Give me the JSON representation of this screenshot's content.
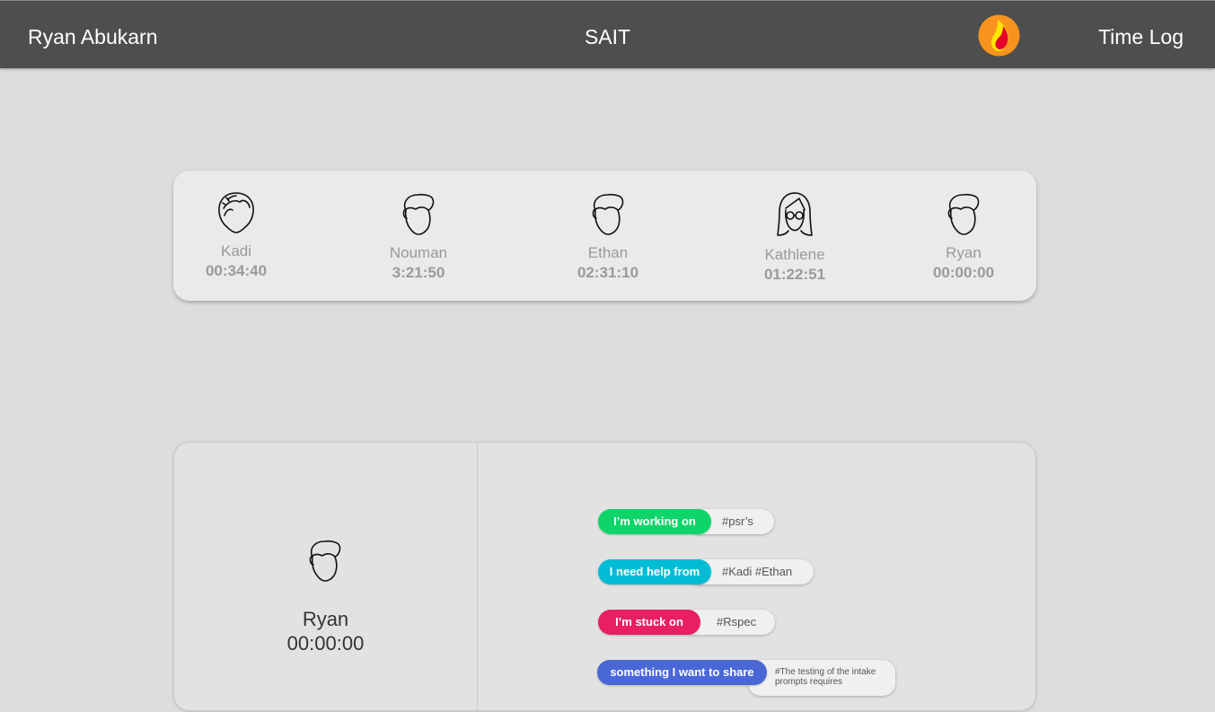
{
  "header": {
    "user_name": "Ryan Abukarn",
    "org_name": "SAIT",
    "nav_label": "Time Log",
    "logo_icon": "flame-logo"
  },
  "team": [
    {
      "name": "Kadi",
      "time": "00:34:40",
      "avatar": "female-short-hair-icon"
    },
    {
      "name": "Nouman",
      "time": "3:21:50",
      "avatar": "male-avatar-icon"
    },
    {
      "name": "Ethan",
      "time": "02:31:10",
      "avatar": "male-avatar-icon"
    },
    {
      "name": "Kathlene",
      "time": "01:22:51",
      "avatar": "female-glasses-avatar-icon"
    },
    {
      "name": "Ryan",
      "time": "00:00:00",
      "avatar": "male-avatar-icon"
    }
  ],
  "selected": {
    "name": "Ryan",
    "time": "00:00:00",
    "avatar": "male-avatar-icon"
  },
  "statuses": [
    {
      "label": "I’m working on",
      "value": "#psr’s",
      "color": "#0fd46a"
    },
    {
      "label": "I need help from",
      "value": "#Kadi #Ethan",
      "color": "#00bcd4"
    },
    {
      "label": "I’m stuck on",
      "value": "#Rspec",
      "color": "#e91e63"
    },
    {
      "label": "something I want to share",
      "value": "#The testing of the intake prompts requires",
      "color": "#4a67d6"
    }
  ],
  "colors": {
    "topbar": "#4e4e4e",
    "background": "#dddddd",
    "card": "#eaeaea"
  }
}
